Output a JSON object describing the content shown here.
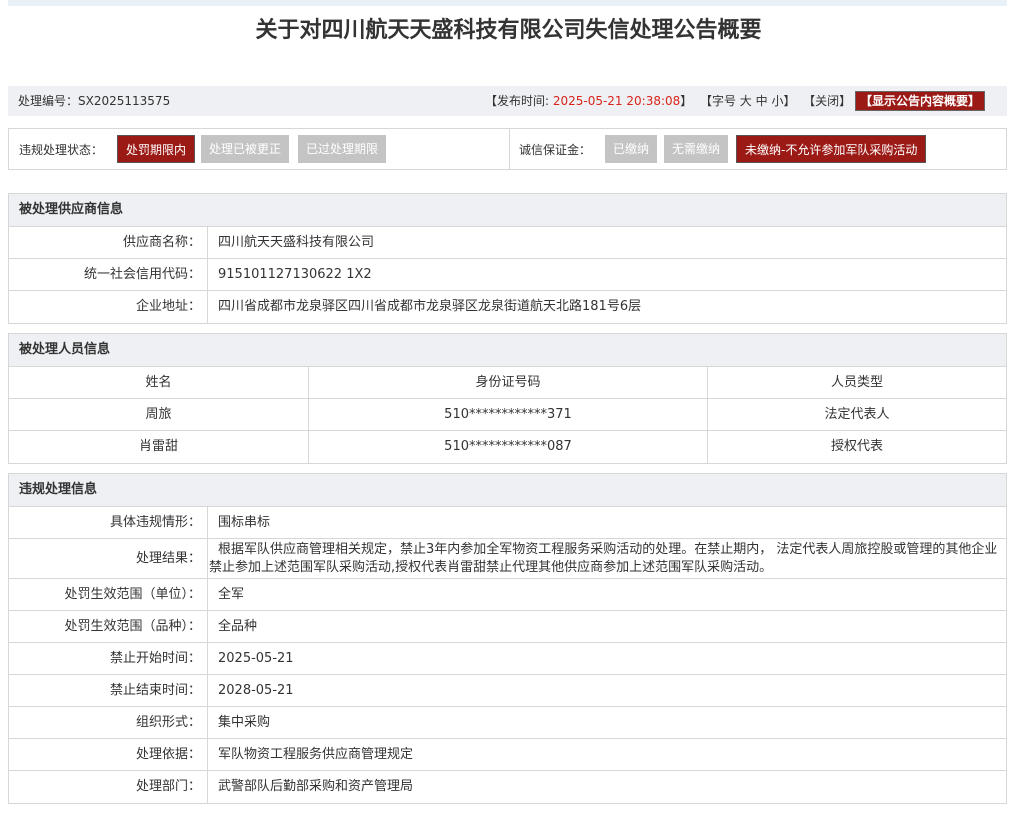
{
  "title": "关于对四川航天天盛科技有限公司失信处理公告概要",
  "meta": {
    "case_label": "处理编号：",
    "case_no": "SX2025113575",
    "publish_label": "【发布时间:",
    "publish_time": "2025-05-21 20:38:08",
    "publish_close": "】",
    "font_label": "【字号",
    "font_large": "大",
    "font_mid": "中",
    "font_small": "小",
    "font_close": "】",
    "close_label": "【关闭】",
    "show_summary": "【显示公告内容概要】"
  },
  "status": {
    "violation_label": "违规处理状态：",
    "violation_tags": [
      {
        "label": "处罚期限内",
        "active": true
      },
      {
        "label": "处理已被更正",
        "active": false
      },
      {
        "label": "已过处理期限",
        "active": false
      }
    ],
    "deposit_label": "诚信保证金：",
    "deposit_tags": [
      {
        "label": "已缴纳",
        "active": false
      },
      {
        "label": "无需缴纳",
        "active": false
      },
      {
        "label": "未缴纳-不允许参加军队采购活动",
        "active": true
      }
    ]
  },
  "supplier": {
    "header": "被处理供应商信息",
    "rows": [
      {
        "k": "供应商名称：",
        "v": "四川航天天盛科技有限公司"
      },
      {
        "k": "统一社会信用代码：",
        "v": "915101127130622 1X2"
      },
      {
        "k": "企业地址：",
        "v": "四川省成都市龙泉驿区四川省成都市龙泉驿区龙泉街道航天北路181号6层"
      }
    ]
  },
  "persons": {
    "header": "被处理人员信息",
    "columns": [
      "姓名",
      "身份证号码",
      "人员类型"
    ],
    "rows": [
      [
        "周旅",
        "510************371",
        "法定代表人"
      ],
      [
        "肖雷甜",
        "510************087",
        "授权代表"
      ]
    ]
  },
  "violation": {
    "header": "违规处理信息",
    "rows": [
      {
        "k": "具体违规情形：",
        "v": "围标串标"
      },
      {
        "k": "处理结果：",
        "v": "根据军队供应商管理相关规定，禁止3年内参加全军物资工程服务采购活动的处理。在禁止期内， 法定代表人周旅控股或管理的其他企业禁止参加上述范围军队采购活动,授权代表肖雷甜禁止代理其他供应商参加上述范围军队采购活动。"
      },
      {
        "k": "处罚生效范围（单位）：",
        "v": "全军"
      },
      {
        "k": "处罚生效范围（品种）：",
        "v": "全品种"
      },
      {
        "k": "禁止开始时间：",
        "v": "2025-05-21"
      },
      {
        "k": "禁止结束时间：",
        "v": "2028-05-21"
      },
      {
        "k": "组织形式：",
        "v": "集中采购"
      },
      {
        "k": "处理依据：",
        "v": "军队物资工程服务供应商管理规定"
      },
      {
        "k": "处理部门：",
        "v": "武警部队后勤部采购和资产管理局"
      }
    ]
  }
}
